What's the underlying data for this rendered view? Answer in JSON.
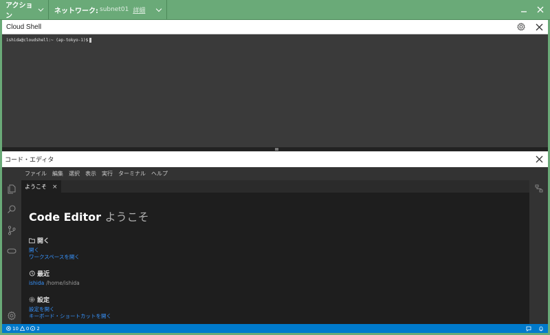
{
  "topbar": {
    "action_label": "アクション",
    "network_label": "ネットワーク:",
    "network_value": "subnet01",
    "details_label": "詳細",
    "minimize_icon": "minimize-icon",
    "close_icon": "close-icon"
  },
  "cloud_shell": {
    "title": "Cloud Shell",
    "prompt": "ishida@cloudshell:~ (ap-tokyo-1)$"
  },
  "code_editor": {
    "title": "コード・エディタ",
    "menu": [
      "ファイル",
      "編集",
      "選択",
      "表示",
      "実行",
      "ターミナル",
      "ヘルプ"
    ],
    "tab": {
      "label": "ようこそ",
      "close": "×"
    },
    "welcome": {
      "title_bold": "Code Editor",
      "title_light": "ようこそ",
      "open": {
        "heading": "開く",
        "links": [
          "開く",
          "ワークスペースを開く"
        ]
      },
      "recent": {
        "heading": "最近",
        "name": "ishida",
        "path": "/home/ishida"
      },
      "settings": {
        "heading": "設定",
        "links": [
          "設定を開く",
          "キーボード・ショートカットを開く"
        ]
      }
    }
  },
  "statusbar": {
    "errors": "10",
    "warnings": "0",
    "info": "2"
  },
  "colors": {
    "topbar": "#6aaa78",
    "terminal_bg": "#3a3a3a",
    "editor_bg": "#1e1e1e",
    "link": "#3794ff",
    "statusbar": "#007acc"
  }
}
